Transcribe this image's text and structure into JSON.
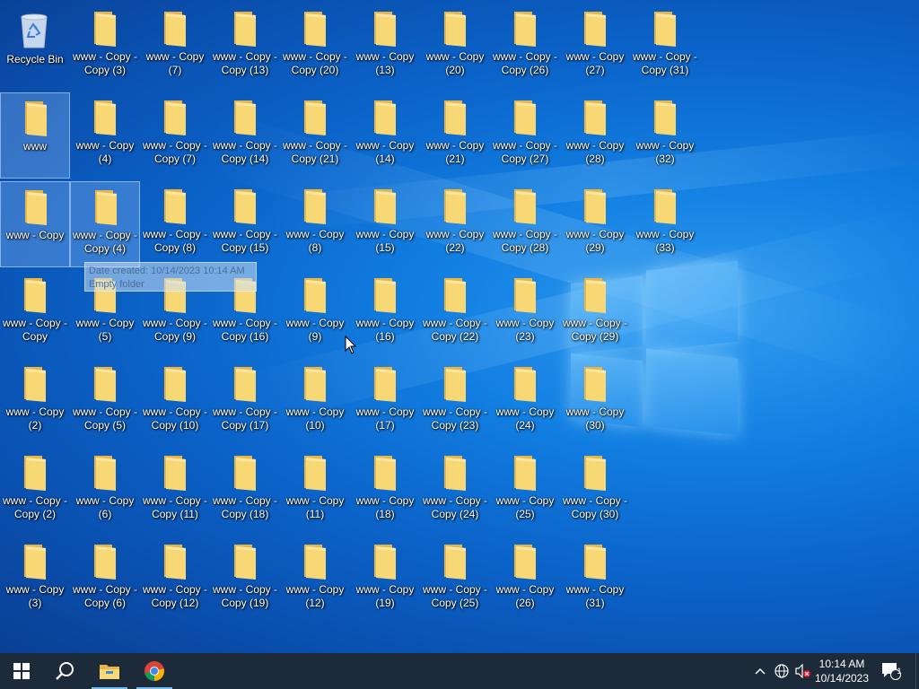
{
  "desktop": {
    "recycle_bin": {
      "label": "Recycle Bin"
    },
    "icons": [
      {
        "label": "www - Copy -\nCopy (3)"
      },
      {
        "label": "www - Copy\n(7)"
      },
      {
        "label": "www - Copy -\nCopy (13)"
      },
      {
        "label": "www - Copy -\nCopy (20)"
      },
      {
        "label": "www - Copy\n(13)"
      },
      {
        "label": "www - Copy\n(20)"
      },
      {
        "label": "www - Copy -\nCopy (26)"
      },
      {
        "label": "www - Copy\n(27)"
      },
      {
        "label": "www - Copy -\nCopy (31)"
      },
      {
        "label": "www"
      },
      {
        "label": "www - Copy\n(4)"
      },
      {
        "label": "www - Copy -\nCopy (7)"
      },
      {
        "label": "www - Copy -\nCopy (14)"
      },
      {
        "label": "www - Copy -\nCopy (21)"
      },
      {
        "label": "www - Copy\n(14)"
      },
      {
        "label": "www - Copy\n(21)"
      },
      {
        "label": "www - Copy -\nCopy (27)"
      },
      {
        "label": "www - Copy\n(28)"
      },
      {
        "label": "www - Copy\n(32)"
      },
      {
        "label": "www - Copy"
      },
      {
        "label": "www - Copy -\nCopy (4)"
      },
      {
        "label": "www - Copy -\nCopy (8)"
      },
      {
        "label": "www - Copy -\nCopy (15)"
      },
      {
        "label": "www - Copy\n(8)"
      },
      {
        "label": "www - Copy\n(15)"
      },
      {
        "label": "www - Copy\n(22)"
      },
      {
        "label": "www - Copy -\nCopy (28)"
      },
      {
        "label": "www - Copy\n(29)"
      },
      {
        "label": "www - Copy\n(33)"
      },
      {
        "label": "www - Copy -\nCopy"
      },
      {
        "label": "www - Copy\n(5)"
      },
      {
        "label": "www - Copy -\nCopy (9)"
      },
      {
        "label": "www - Copy -\nCopy (16)"
      },
      {
        "label": "www - Copy\n(9)"
      },
      {
        "label": "www - Copy\n(16)"
      },
      {
        "label": "www - Copy -\nCopy (22)"
      },
      {
        "label": "www - Copy\n(23)"
      },
      {
        "label": "www - Copy -\nCopy (29)"
      },
      {
        "label": "www - Copy\n(2)"
      },
      {
        "label": "www - Copy -\nCopy (5)"
      },
      {
        "label": "www - Copy -\nCopy (10)"
      },
      {
        "label": "www - Copy -\nCopy (17)"
      },
      {
        "label": "www - Copy\n(10)"
      },
      {
        "label": "www - Copy\n(17)"
      },
      {
        "label": "www - Copy -\nCopy (23)"
      },
      {
        "label": "www - Copy\n(24)"
      },
      {
        "label": "www - Copy\n(30)"
      },
      {
        "label": "www - Copy -\nCopy (2)"
      },
      {
        "label": "www - Copy\n(6)"
      },
      {
        "label": "www - Copy -\nCopy (11)"
      },
      {
        "label": "www - Copy -\nCopy (18)"
      },
      {
        "label": "www - Copy\n(11)"
      },
      {
        "label": "www - Copy\n(18)"
      },
      {
        "label": "www - Copy -\nCopy (24)"
      },
      {
        "label": "www - Copy\n(25)"
      },
      {
        "label": "www - Copy -\nCopy (30)"
      },
      {
        "label": "www - Copy\n(3)"
      },
      {
        "label": "www - Copy -\nCopy (6)"
      },
      {
        "label": "www - Copy -\nCopy (12)"
      },
      {
        "label": "www - Copy -\nCopy (19)"
      },
      {
        "label": "www - Copy\n(12)"
      },
      {
        "label": "www - Copy\n(19)"
      },
      {
        "label": "www - Copy -\nCopy (25)"
      },
      {
        "label": "www - Copy\n(26)"
      },
      {
        "label": "www - Copy\n(31)"
      }
    ],
    "selected_labels": [
      "www",
      "www - Copy",
      "www - Copy -\nCopy (4)"
    ],
    "tooltip": {
      "date_created": "Date created: 10/14/2023 10:14 AM",
      "description": "Empty folder"
    }
  },
  "taskbar": {
    "start": "windows-start-icon",
    "search": "search-icon",
    "file_explorer": "file-explorer-icon",
    "chrome": "chrome-icon",
    "tray": {
      "chevron": "chevron-up-icon",
      "network": "globe-network-icon",
      "volume": "volume-muted-icon",
      "time": "10:14 AM",
      "date": "10/14/2023",
      "notifications_count": "1"
    }
  },
  "colors": {
    "desktop_blue": "#0b63c9",
    "taskbar": "#1d2a3a",
    "folder_yellow": "#f8d775",
    "chrome_red": "#db4437",
    "chrome_green": "#0f9d58",
    "chrome_yellow": "#f4b400",
    "chrome_blue": "#4285f4"
  }
}
